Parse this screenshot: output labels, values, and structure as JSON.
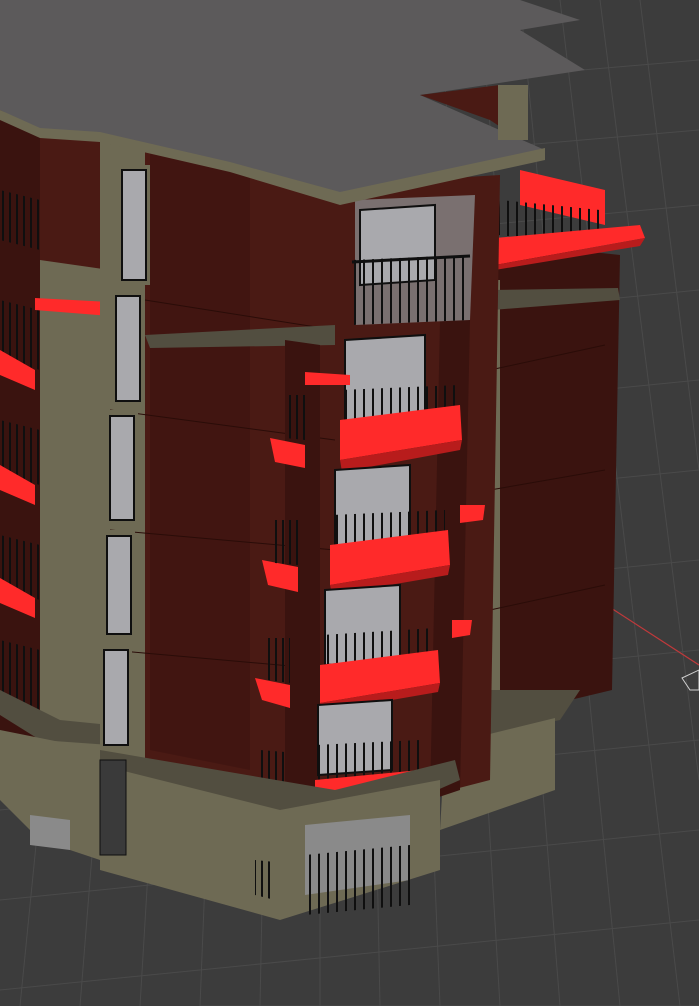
{
  "viewport": {
    "background": "#3c3c3c",
    "grid_color": "#4a4a4a",
    "x_axis_color": "#c0393b"
  },
  "building": {
    "wall_color": "#4a1a14",
    "wall_shade": "#3a130f",
    "trim_color": "#6e6a54",
    "roof_color": "#5c5a5b",
    "window_color": "#a9a9ad",
    "railing_color": "#0f0f0f",
    "selected_color": "#ff2a2a"
  }
}
